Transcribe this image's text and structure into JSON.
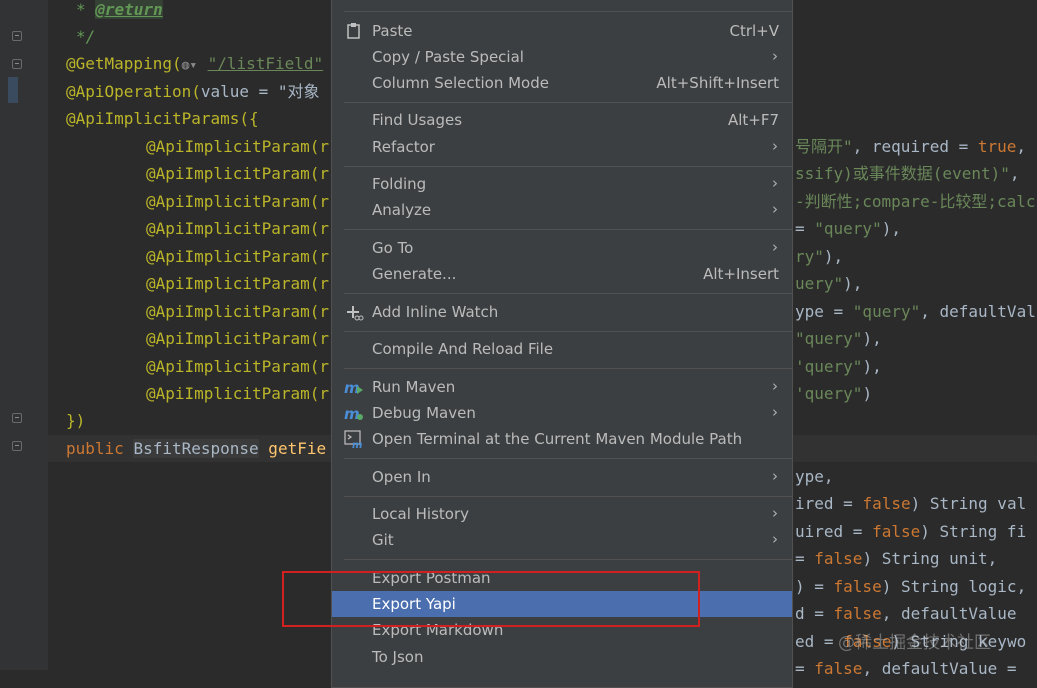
{
  "editor": {
    "lines": [
      {
        "star": "* ",
        "tag": "@return"
      },
      {
        "text": "*/"
      },
      {
        "ann": "@GetMapping(",
        "link": "\"/listField\""
      },
      {
        "ann": "@ApiOperation(",
        "rest": "value = \"对象"
      },
      {
        "ann": "@ApiImplicitParams({"
      },
      {
        "ann": "@ApiImplicitParam(r"
      },
      {
        "ann": "@ApiImplicitParam(r"
      },
      {
        "ann": "@ApiImplicitParam(r"
      },
      {
        "ann": "@ApiImplicitParam(r"
      },
      {
        "ann": "@ApiImplicitParam(r"
      },
      {
        "ann": "@ApiImplicitParam(r"
      },
      {
        "ann": "@ApiImplicitParam(r"
      },
      {
        "ann": "@ApiImplicitParam(r"
      },
      {
        "ann": "@ApiImplicitParam(r"
      },
      {
        "ann": "@ApiImplicitParam(r"
      },
      {
        "ann": "})"
      },
      {
        "kw": "public ",
        "cls": "BsfitResponse",
        "method": " getFie"
      }
    ],
    "right": [
      {
        "str": "号隔开\"",
        "rest": ", required = ",
        "kw": "true",
        "tail": ","
      },
      {
        "str": "ssify)或事件数据(event)\"",
        "rest": ","
      },
      {
        "str": "-判断性;compare-比较型;calc"
      },
      {
        "rest": "= ",
        "str": "\"query\"",
        "tail": "),"
      },
      {
        "str": "ry\"",
        "tail": "),"
      },
      {
        "str": "uery\"",
        "tail": "),"
      },
      {
        "rest": "ype = ",
        "str": "\"query\"",
        "tail": ", defaultVal"
      },
      {
        "str": "\"query\"",
        "tail": "),"
      },
      {
        "str": "'query\"",
        "tail": "),"
      },
      {
        "str": "'query\"",
        "tail": ")"
      },
      {
        "rest": "ype,"
      },
      {
        "rest": "ired = ",
        "kw": "false",
        "tail": ") String val"
      },
      {
        "rest": "uired = ",
        "kw": "false",
        "tail": ") String fi"
      },
      {
        "rest": "= ",
        "kw": "false",
        "tail": ") String unit,"
      },
      {
        "rest": ") = ",
        "kw": "false",
        "tail": ") String logic,"
      },
      {
        "rest": "d = ",
        "kw": "false",
        "tail": ", defaultValue"
      },
      {
        "rest": "ed = ",
        "kw": "false",
        "tail": ") String keywo"
      },
      {
        "rest": "= ",
        "kw": "false",
        "tail": ", defaultValue ="
      }
    ]
  },
  "menu": {
    "items": [
      {
        "label": "Paste",
        "shortcut": "Ctrl+V",
        "icon": "clipboard-icon"
      },
      {
        "label": "Copy / Paste Special",
        "submenu": true
      },
      {
        "label": "Column Selection Mode",
        "shortcut": "Alt+Shift+Insert"
      },
      {
        "label": "Find Usages",
        "shortcut": "Alt+F7"
      },
      {
        "label": "Refactor",
        "submenu": true
      },
      {
        "label": "Folding",
        "submenu": true
      },
      {
        "label": "Analyze",
        "submenu": true
      },
      {
        "label": "Go To",
        "submenu": true
      },
      {
        "label": "Generate...",
        "shortcut": "Alt+Insert"
      },
      {
        "label": "Add Inline Watch",
        "icon": "add-watch-icon"
      },
      {
        "label": "Compile And Reload File"
      },
      {
        "label": "Run Maven",
        "submenu": true,
        "icon": "maven-run-icon"
      },
      {
        "label": "Debug Maven",
        "submenu": true,
        "icon": "maven-debug-icon"
      },
      {
        "label": "Open Terminal at the Current Maven Module Path",
        "icon": "maven-terminal-icon"
      },
      {
        "label": "Open In",
        "submenu": true
      },
      {
        "label": "Local History",
        "submenu": true
      },
      {
        "label": "Git",
        "submenu": true
      },
      {
        "label": "Export Postman"
      },
      {
        "label": "Export Yapi",
        "selected": true
      },
      {
        "label": "Export Markdown"
      },
      {
        "label": "To Json"
      }
    ],
    "submenu_arrow": "›"
  },
  "watermark": "@稀土掘金技术社区",
  "colors": {
    "menu_bg": "#3c3f41",
    "selected": "#4b6eaf",
    "highlight_box": "#d02020",
    "editor_bg": "#2b2b2b"
  }
}
